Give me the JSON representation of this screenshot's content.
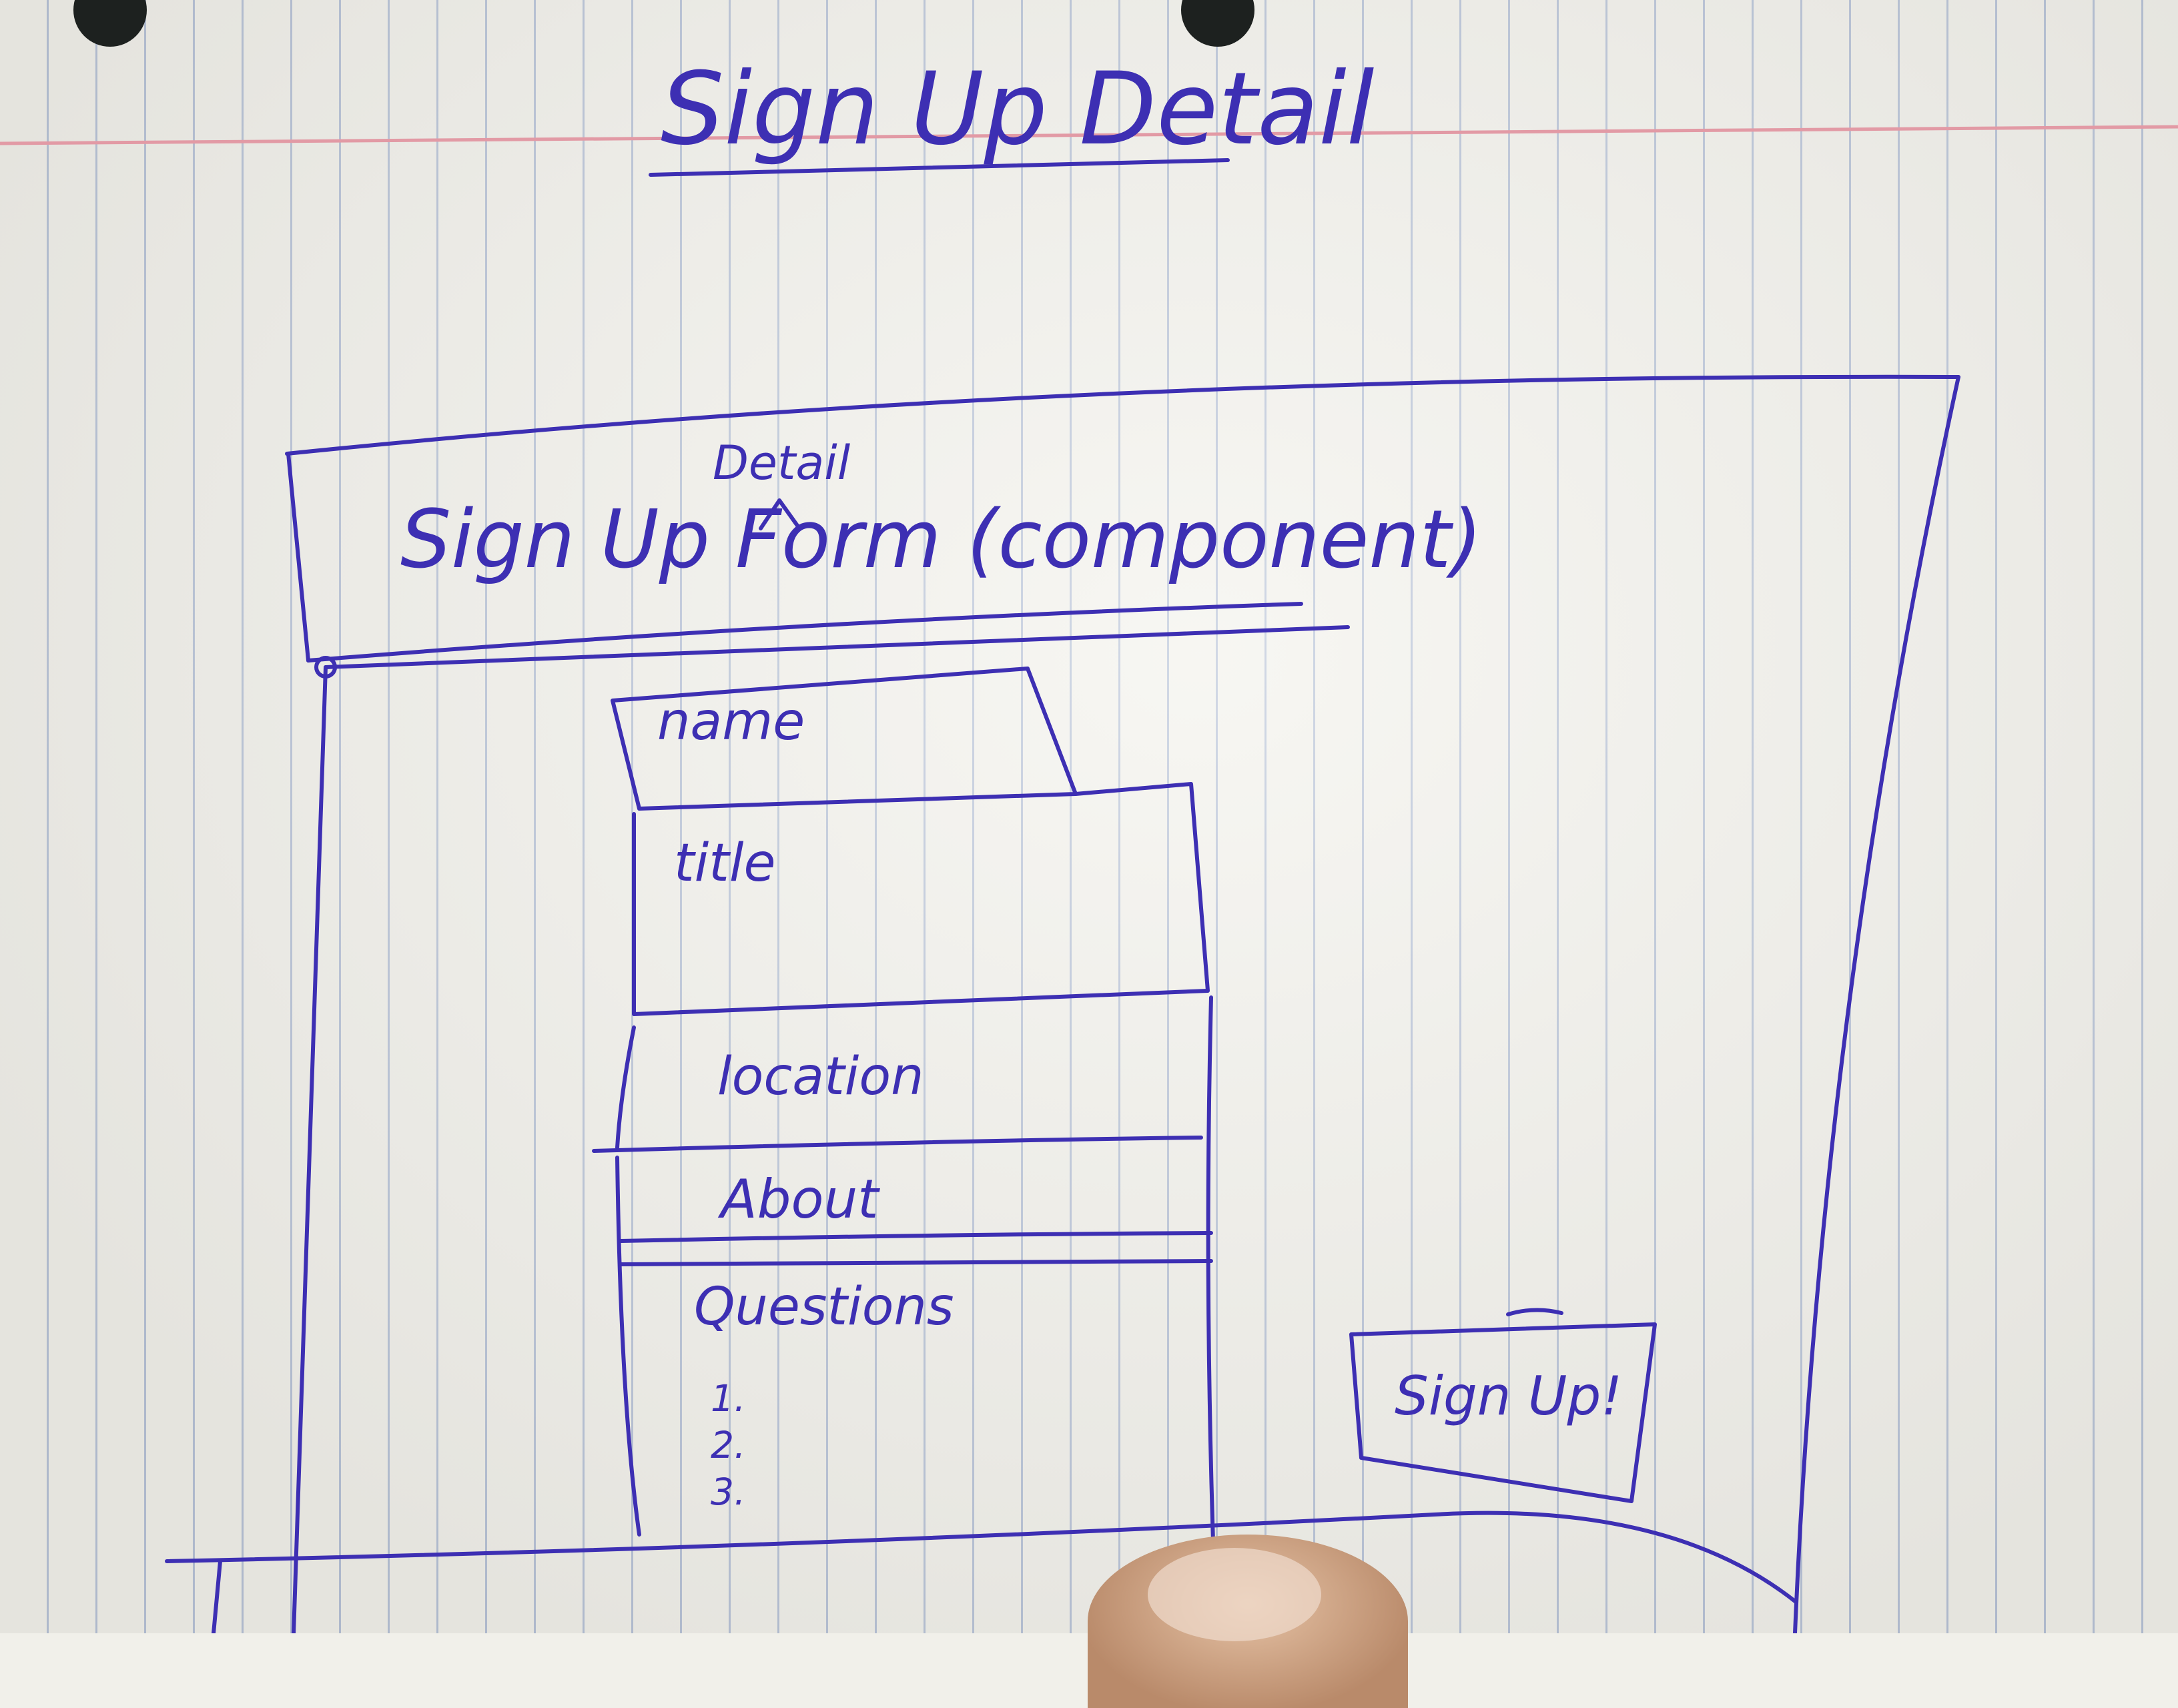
{
  "page_title": "Sign Up Detail",
  "component_title": "Sign Up Form (component)",
  "insert_word": "Detail",
  "fields": {
    "name": "name",
    "title": "title",
    "location": "location",
    "about": "About",
    "questions": "Questions",
    "q1": "1.",
    "q2": "2.",
    "q3": "3."
  },
  "signup_button": "Sign Up!",
  "colors": {
    "ink": "#3d2fb3",
    "paper": "#f3f2ec",
    "margin_red": "#e29aa5",
    "rule": "#b9c4d8"
  }
}
